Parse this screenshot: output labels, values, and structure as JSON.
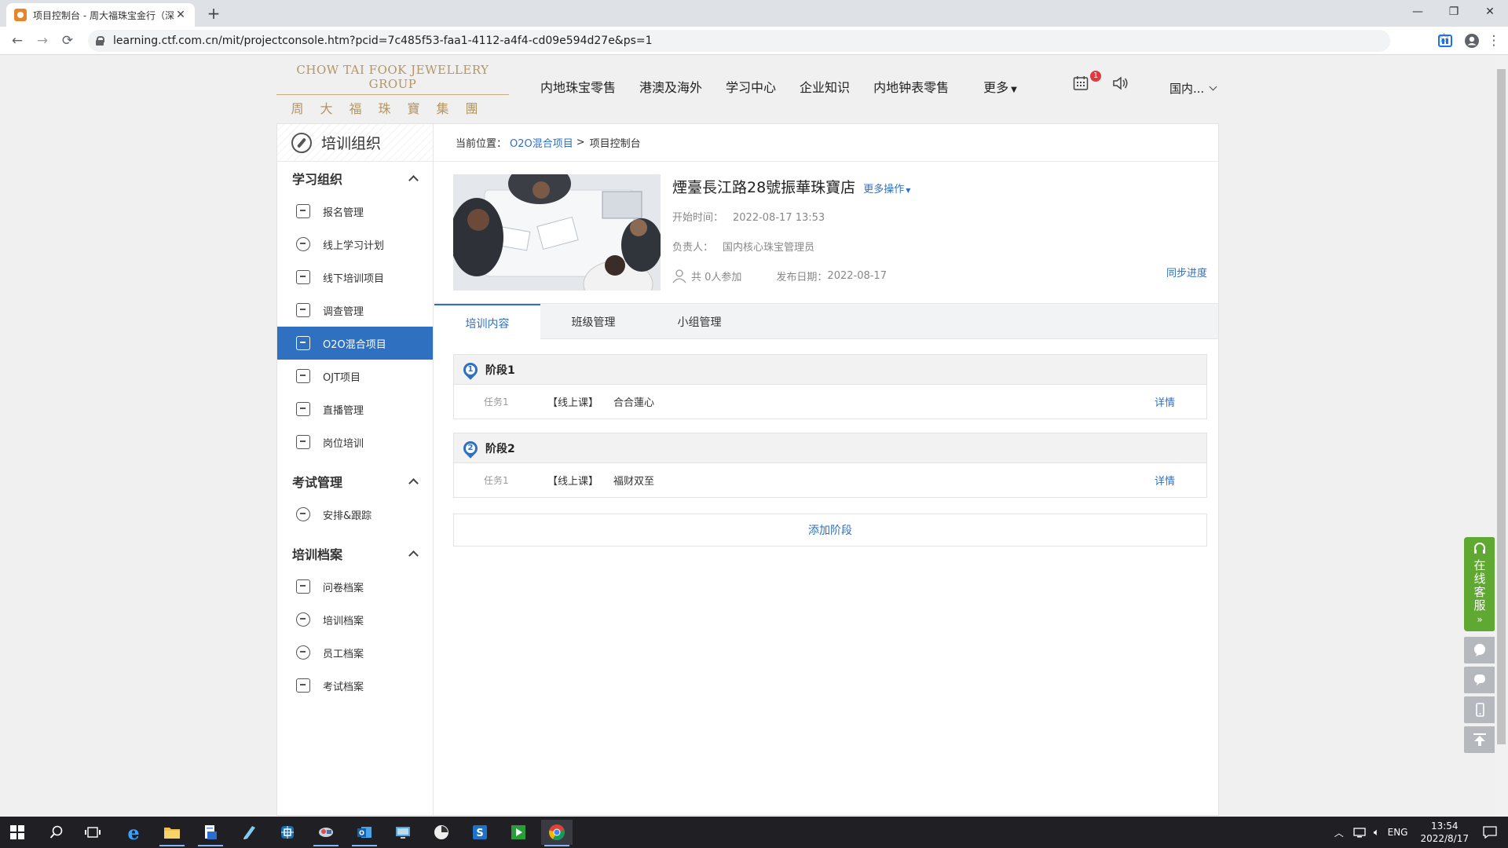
{
  "browser": {
    "tab_title": "项目控制台 - 周大福珠宝金行（深",
    "url": "learning.ctf.com.cn/mit/projectconsole.htm?pcid=7c485f53-faa1-4112-a4f4-cd09e594d27e&ps=1"
  },
  "header": {
    "logo_en": "CHOW TAI FOOK JEWELLERY GROUP",
    "logo_cn": "周大福珠寶集團",
    "nav": [
      "内地珠宝零售",
      "港澳及海外",
      "学习中心",
      "企业知识",
      "内地钟表零售",
      "更多"
    ],
    "notification_count": "1",
    "region": "国内..."
  },
  "sidebar": {
    "title": "培训组织",
    "groups": [
      {
        "label": "学习组织",
        "items": [
          "报名管理",
          "线上学习计划",
          "线下培训项目",
          "调查管理",
          "O2O混合项目",
          "OJT项目",
          "直播管理",
          "岗位培训"
        ]
      },
      {
        "label": "考试管理",
        "items": [
          "安排&跟踪"
        ]
      },
      {
        "label": "培训档案",
        "items": [
          "问卷档案",
          "培训档案",
          "员工档案",
          "考试档案"
        ]
      }
    ],
    "active_item": "O2O混合项目"
  },
  "breadcrumb": {
    "prefix": "当前位置：",
    "link": "O2O混合项目",
    "sep": ">",
    "current": "项目控制台"
  },
  "project": {
    "name": "煙臺長江路28號振華珠寶店",
    "more_ops": "更多操作",
    "start_label": "开始时间：",
    "start_value": "2022-08-17 13:53",
    "owner_label": "负责人：",
    "owner_value": "国内核心珠宝管理员",
    "participants": "共 0人参加",
    "publish_label": "发布日期：",
    "publish_value": "2022-08-17",
    "sync": "同步进度"
  },
  "tabs": [
    "培训内容",
    "班级管理",
    "小组管理"
  ],
  "stages": [
    {
      "num": "1",
      "title": "阶段1",
      "tasks": [
        {
          "no": "任务1",
          "type": "【线上课】",
          "name": "合合蓮心",
          "action": "详情"
        }
      ]
    },
    {
      "num": "2",
      "title": "阶段2",
      "tasks": [
        {
          "no": "任务1",
          "type": "【线上课】",
          "name": "福财双至",
          "action": "详情"
        }
      ]
    }
  ],
  "add_stage": "添加阶段",
  "customer_service": "在线客服",
  "taskbar": {
    "lang": "ENG",
    "time": "13:54",
    "date": "2022/8/17"
  },
  "colors": {
    "accent": "#2f70c1",
    "logo_gold": "#b49563",
    "cs_green": "#5fa832"
  }
}
